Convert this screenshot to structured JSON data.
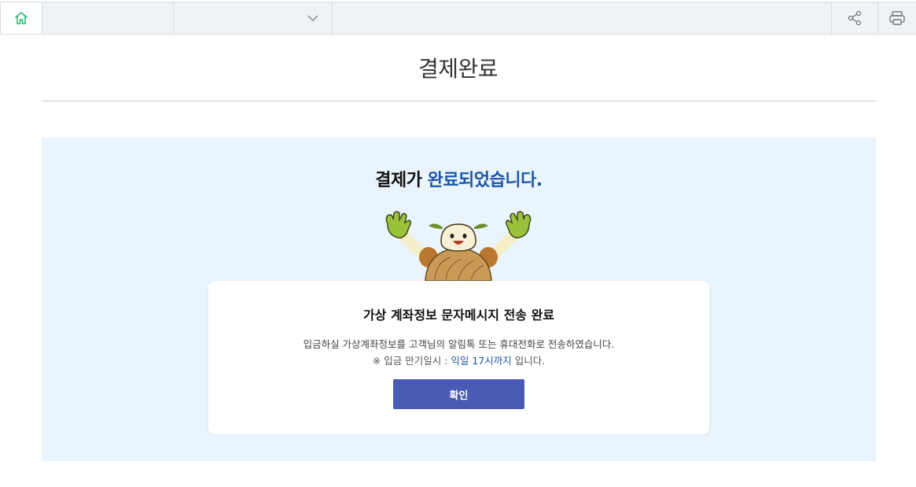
{
  "page": {
    "title": "결제완료"
  },
  "topbar": {
    "home_icon": "home-icon",
    "dropdown_icon": "chevron-down-icon",
    "share_icon": "share-icon",
    "print_icon": "print-icon"
  },
  "result": {
    "headline_prefix": "결제가 ",
    "headline_accent": "완료되었습니다.",
    "mascot": "tree-mascot-illustration"
  },
  "card": {
    "title": "가상 계좌정보 문자메시지 전송 완료",
    "description": "입금하실 가상계좌정보를 고객님의 알림톡 또는 휴대전화로 전송하였습니다.",
    "note_prefix": "※ 입금 만기일시 : ",
    "note_highlight": "익일 17시까지",
    "note_suffix": " 입니다.",
    "confirm_label": "확인"
  },
  "colors": {
    "accent": "#1c58a8",
    "button": "#4a5bb5",
    "panel_bg": "#eaf4fd",
    "home_icon": "#2bb673"
  }
}
